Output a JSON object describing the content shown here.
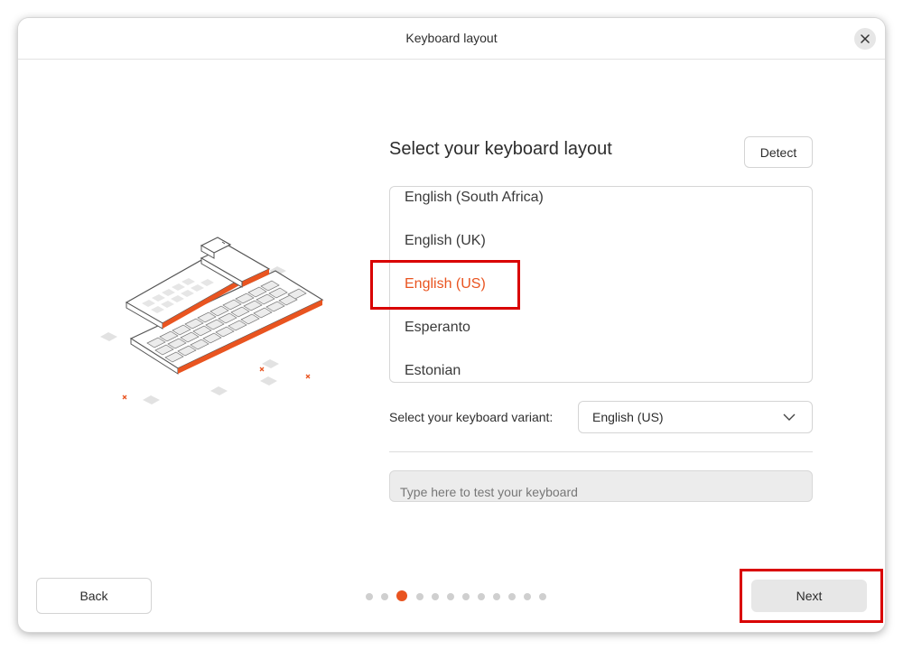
{
  "window": {
    "title": "Keyboard layout"
  },
  "main": {
    "heading": "Select your keyboard layout",
    "detect_label": "Detect",
    "layouts": [
      {
        "label": "English (South Africa)",
        "selected": false
      },
      {
        "label": "English (UK)",
        "selected": false
      },
      {
        "label": "English (US)",
        "selected": true
      },
      {
        "label": "Esperanto",
        "selected": false
      },
      {
        "label": "Estonian",
        "selected": false
      }
    ],
    "variant_label": "Select your keyboard variant:",
    "variant_value": "English (US)",
    "test_placeholder": "Type here to test your keyboard",
    "test_value": ""
  },
  "footer": {
    "back_label": "Back",
    "next_label": "Next",
    "steps_total": 12,
    "current_step": 3
  },
  "icons": {
    "close": "close-icon",
    "chevron": "chevron-down-icon",
    "illustration": "keyboard-illustration"
  },
  "colors": {
    "accent": "#e95420",
    "highlight": "#d90000",
    "next_button_bg": "#e7e7e7"
  }
}
